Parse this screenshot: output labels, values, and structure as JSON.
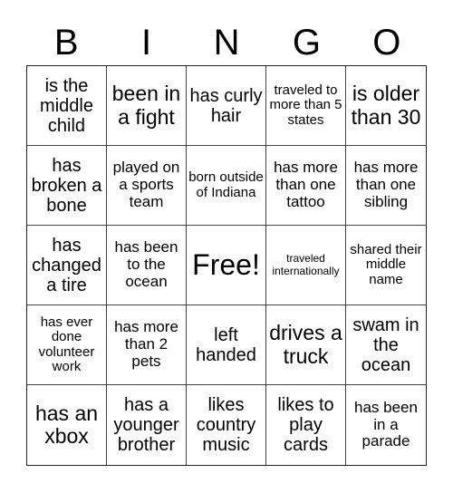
{
  "header": [
    "B",
    "I",
    "N",
    "G",
    "O"
  ],
  "cells": [
    {
      "text": "is the middle child",
      "size": "m"
    },
    {
      "text": "been in a fight",
      "size": "l"
    },
    {
      "text": "has curly hair",
      "size": "m"
    },
    {
      "text": "traveled to more than 5 states",
      "size": "xs"
    },
    {
      "text": "is older than 30",
      "size": "l"
    },
    {
      "text": "has broken a bone",
      "size": "m"
    },
    {
      "text": "played on a sports team",
      "size": "s"
    },
    {
      "text": "born outside of Indiana",
      "size": "xs"
    },
    {
      "text": "has more than one tattoo",
      "size": "s"
    },
    {
      "text": "has more than one sibling",
      "size": "s"
    },
    {
      "text": "has changed a tire",
      "size": "m"
    },
    {
      "text": "has been to the ocean",
      "size": "s"
    },
    {
      "text": "Free!",
      "size": "xl"
    },
    {
      "text": "traveled internationally",
      "size": "xxs"
    },
    {
      "text": "shared their middle name",
      "size": "xs"
    },
    {
      "text": "has ever done volunteer work",
      "size": "xs"
    },
    {
      "text": "has more than 2 pets",
      "size": "s"
    },
    {
      "text": "left handed",
      "size": "m"
    },
    {
      "text": "drives a truck",
      "size": "l"
    },
    {
      "text": "swam in the ocean",
      "size": "m"
    },
    {
      "text": "has an xbox",
      "size": "l"
    },
    {
      "text": "has a younger brother",
      "size": "m"
    },
    {
      "text": "likes country music",
      "size": "m"
    },
    {
      "text": "likes to play cards",
      "size": "m"
    },
    {
      "text": "has been in a parade",
      "size": "s"
    }
  ]
}
